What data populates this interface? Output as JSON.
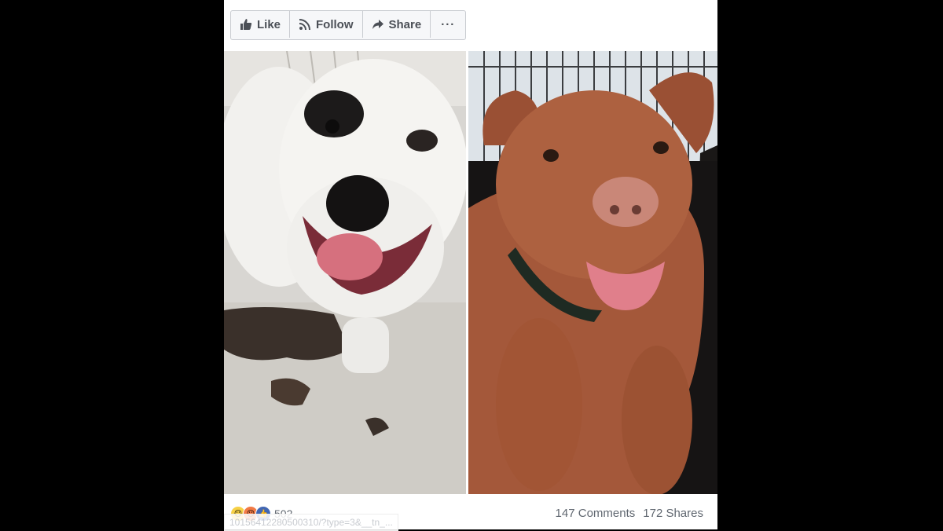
{
  "actions": {
    "like_label": "Like",
    "follow_label": "Follow",
    "share_label": "Share",
    "more_label": "···"
  },
  "photos": {
    "left_icon": "white-pit-bull-photo",
    "right_icon": "brown-pit-bull-photo"
  },
  "footer": {
    "reaction_count": "502",
    "comments": "147 Comments",
    "shares": "172 Shares",
    "status_url": "10156412280500310/?type=3&__tn_..."
  },
  "colors": {
    "like_blue": "#4267b2",
    "text_gray": "#606770"
  }
}
